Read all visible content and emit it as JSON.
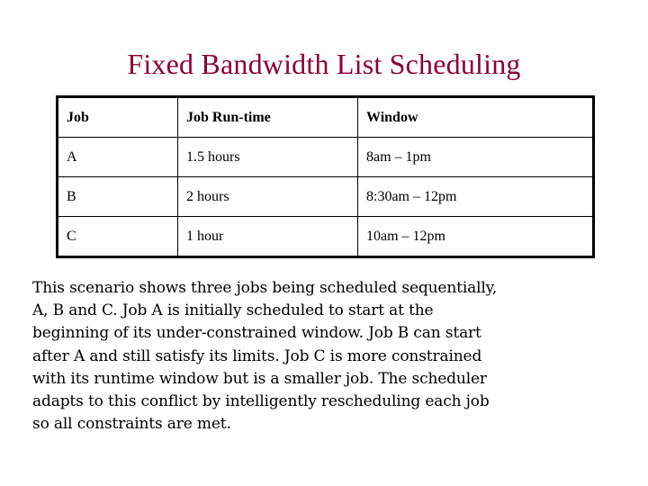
{
  "slide": {
    "title": "Fixed Bandwidth List Scheduling",
    "title_color": "#8c0038",
    "background_color": "#ffffff",
    "text_color": "#000000"
  },
  "table": {
    "headers": [
      "Job",
      "Job Run-time",
      "Window"
    ],
    "rows": [
      {
        "job": "A",
        "runtime": "1.5 hours",
        "window": "8am – 1pm"
      },
      {
        "job": "B",
        "runtime": "2 hours",
        "window": "8:30am – 12pm"
      },
      {
        "job": "C",
        "runtime": "1 hour",
        "window": "10am – 12pm"
      }
    ],
    "border_color": "#000000"
  },
  "body": {
    "full_text": "This scenario shows three jobs being scheduled sequentially, A, B and C.  Job A is initially scheduled to start at the beginning of its under-constrained window.  Job B can start after A and still satisfy its limits.  Job C is more constrained with its runtime window but is a smaller job.  The scheduler adapts to this conflict by intelligently rescheduling each job so all constraints are met.",
    "lines": [
      "This scenario shows three jobs being scheduled sequentially,",
      "A, B and C.  Job A is initially scheduled to start at the",
      "beginning of its under-constrained window.  Job B can start",
      "after A and still satisfy its limits.  Job C is more constrained",
      "with its runtime window but is a smaller job.  The scheduler",
      "adapts to this conflict by intelligently rescheduling each job",
      "so all constraints are met."
    ]
  }
}
